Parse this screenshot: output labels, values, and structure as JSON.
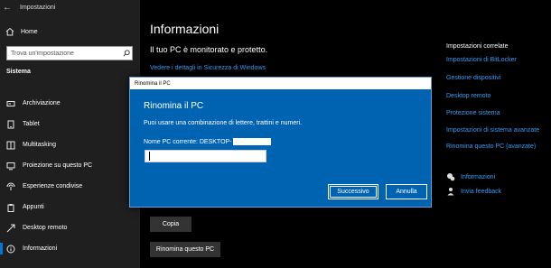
{
  "window": {
    "title": "Impostazioni"
  },
  "sidebar": {
    "home_label": "Home",
    "search_placeholder": "Trova un'impostazione",
    "section_label": "Sistema",
    "items": [
      {
        "label": "Archiviazione",
        "icon": "storage-icon"
      },
      {
        "label": "Tablet",
        "icon": "tablet-icon"
      },
      {
        "label": "Multitasking",
        "icon": "multitasking-icon"
      },
      {
        "label": "Proiezione su questo PC",
        "icon": "projection-icon"
      },
      {
        "label": "Esperienze condivise",
        "icon": "shared-experiences-icon"
      },
      {
        "label": "Appunti",
        "icon": "clipboard-icon"
      },
      {
        "label": "Desktop remoto",
        "icon": "remote-desktop-icon"
      },
      {
        "label": "Informazioni",
        "icon": "info-icon",
        "active": true
      }
    ]
  },
  "main": {
    "title": "Informazioni",
    "subtitle": "Il tuo PC è monitorato e protetto.",
    "security_link": "Vedere i dettagli in Sicurezza di Windows",
    "copy_button": "Copia",
    "rename_button": "Rinomina questo PC"
  },
  "related": {
    "title": "Impostazioni correlate",
    "links": [
      "Impostazioni di BitLocker",
      "Gestione dispositivi",
      "Desktop remoto",
      "Protezione sistema",
      "Impostazioni di sistema avanzate",
      "Rinomina questo PC (avanzate)"
    ],
    "help": [
      {
        "label": "Informazioni",
        "icon": "help-chat-icon"
      },
      {
        "label": "Invia feedback",
        "icon": "feedback-icon"
      }
    ]
  },
  "dialog": {
    "titlebar": "Rinomina il PC",
    "heading": "Rinomina il PC",
    "description": "Puoi usare una combinazione di lettere, trattini e numeri.",
    "current_name_label": "Nome PC corrente: DESKTOP-",
    "input_value": "",
    "next_button": "Successivo",
    "cancel_button": "Annulla"
  },
  "colors": {
    "accent": "#0078d7",
    "dialog_bg": "#0063b1",
    "link": "#3a9bf2",
    "sidebar_bg": "#1f1f1f",
    "content_bg": "#000000"
  }
}
